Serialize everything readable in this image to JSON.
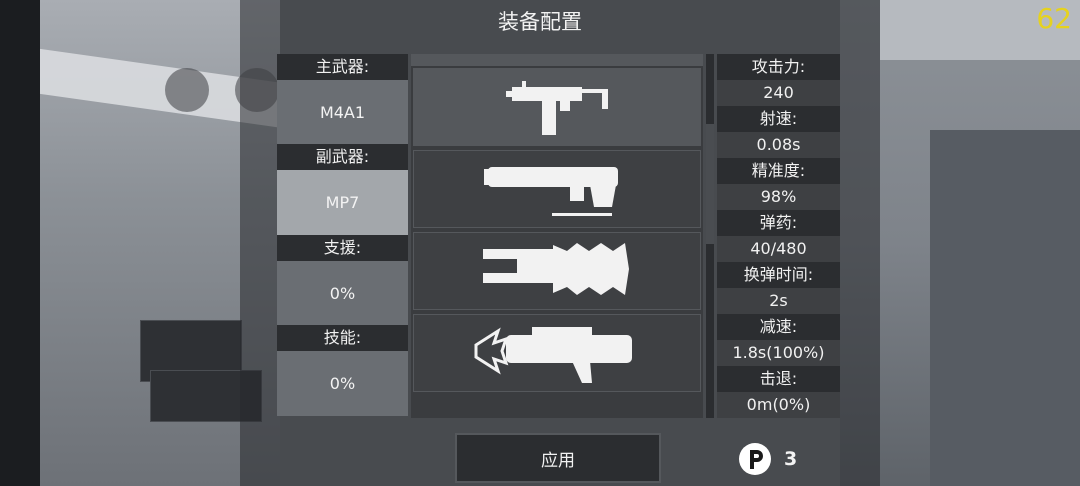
{
  "title": "装备配置",
  "fps": "62",
  "loadout": {
    "primary_label": "主武器:",
    "primary_value": "M4A1",
    "secondary_label": "副武器:",
    "secondary_value": "MP7",
    "support_label": "支援:",
    "support_value": "0%",
    "skill_label": "技能:",
    "skill_value": "0%"
  },
  "weapons": [
    {
      "icon": "smg-icon",
      "selected": true
    },
    {
      "icon": "launcher-icon",
      "selected": false
    },
    {
      "icon": "spiked-cannon-icon",
      "selected": false
    },
    {
      "icon": "claw-gun-icon",
      "selected": false
    }
  ],
  "stats": [
    {
      "label": "攻击力:",
      "value": "240"
    },
    {
      "label": "射速:",
      "value": "0.08s"
    },
    {
      "label": "精准度:",
      "value": "98%"
    },
    {
      "label": "弹药:",
      "value": "40/480"
    },
    {
      "label": "换弹时间:",
      "value": "2s"
    },
    {
      "label": "减速:",
      "value": "1.8s(100%)"
    },
    {
      "label": "击退:",
      "value": "0m(0%)"
    }
  ],
  "apply_label": "应用",
  "points": {
    "icon": "points-p-icon",
    "value": "3"
  },
  "colors": {
    "fps": "#e6d21e",
    "panel_dark": "#2b2d30",
    "panel_mid": "#3e4043"
  }
}
